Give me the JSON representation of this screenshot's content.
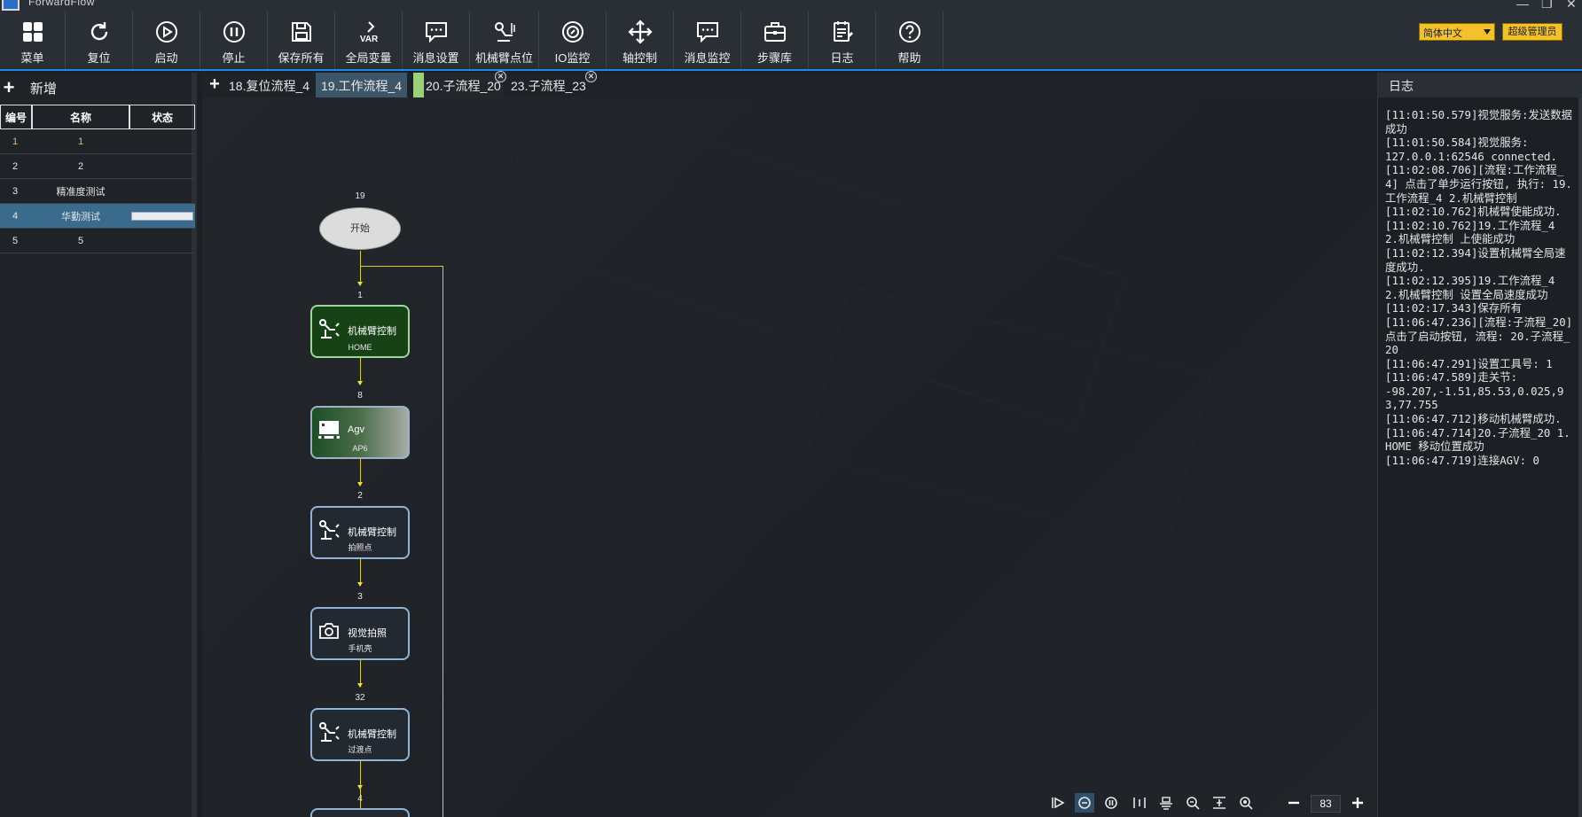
{
  "window": {
    "title": "ForwardFlow",
    "controls": [
      "—",
      "❐",
      "✕"
    ]
  },
  "toolbar": {
    "items": [
      {
        "label": "菜单",
        "icon": "grid-icon"
      },
      {
        "label": "复位",
        "icon": "reset-icon"
      },
      {
        "label": "启动",
        "icon": "play-icon"
      },
      {
        "label": "停止",
        "icon": "pause-icon"
      },
      {
        "label": "保存所有",
        "icon": "save-icon"
      },
      {
        "label": "全局变量",
        "icon": "var-icon",
        "icon_text": "VAR"
      },
      {
        "label": "消息设置",
        "icon": "message-settings-icon"
      },
      {
        "label": "机械臂点位",
        "icon": "robot-arm-points-icon"
      },
      {
        "label": "IO监控",
        "icon": "io-monitor-icon"
      },
      {
        "label": "轴控制",
        "icon": "axis-control-icon"
      },
      {
        "label": "消息监控",
        "icon": "message-monitor-icon"
      },
      {
        "label": "步骤库",
        "icon": "toolbox-icon"
      },
      {
        "label": "日志",
        "icon": "log-icon"
      },
      {
        "label": "帮助",
        "icon": "help-icon"
      }
    ],
    "language": "简体中文",
    "role": "超级管理员"
  },
  "left_panel": {
    "add_label": "新增",
    "columns": [
      "编号",
      "名称",
      "状态"
    ],
    "rows": [
      {
        "id": "1",
        "name": "1",
        "status": ""
      },
      {
        "id": "2",
        "name": "2",
        "status": ""
      },
      {
        "id": "3",
        "name": "精准度测试",
        "status": ""
      },
      {
        "id": "4",
        "name": "华勤测试",
        "status": "progress",
        "progress": 0.02
      },
      {
        "id": "5",
        "name": "5",
        "status": ""
      }
    ],
    "selected_index": 3
  },
  "tabs": [
    {
      "label": "18.复位流程_4",
      "state": "normal"
    },
    {
      "label": "19.工作流程_4",
      "state": "active"
    },
    {
      "label": "20.子流程_20",
      "state": "running",
      "closable": true
    },
    {
      "label": "23.子流程_23",
      "state": "normal",
      "closable": true
    }
  ],
  "flow": {
    "start": {
      "label": "开始",
      "number": "19"
    },
    "nodes": [
      {
        "number": "1",
        "title": "机械臂控制",
        "sub": "HOME",
        "style": "green",
        "icon": "robot-arm-icon"
      },
      {
        "number": "8",
        "title": "Agv",
        "sub": "AP6",
        "style": "grad",
        "icon": "agv-icon"
      },
      {
        "number": "2",
        "title": "机械臂控制",
        "sub": "拍照点",
        "style": "normal",
        "icon": "robot-arm-icon"
      },
      {
        "number": "3",
        "title": "视觉拍照",
        "sub": "手机壳",
        "style": "normal",
        "icon": "camera-icon"
      },
      {
        "number": "32",
        "title": "机械臂控制",
        "sub": "过渡点",
        "style": "normal",
        "icon": "robot-arm-icon"
      }
    ],
    "next_number": "4"
  },
  "canvas_tools": {
    "items": [
      "step-run-icon",
      "stop-circle-icon",
      "pause-circle-icon",
      "align-vertical-icon",
      "align-horizontal-icon",
      "zoom-fit-icon",
      "distribute-icon",
      "locate-icon"
    ],
    "active_index": 1,
    "zoom": "83"
  },
  "log": {
    "title": "日志",
    "text": "[11:01:50.579]视觉服务:发送数据成功\n[11:01:50.584]视觉服务:\n127.0.0.1:62546 connected.\n[11:02:08.706][流程:工作流程_4] 点击了单步运行按钮, 执行: 19.工作流程_4 2.机械臂控制\n[11:02:10.762]机械臂使能成功.\n[11:02:10.762]19.工作流程_4 2.机械臂控制 上使能成功\n[11:02:12.394]设置机械臂全局速度成功.\n[11:02:12.395]19.工作流程_4 2.机械臂控制 设置全局速度成功\n[11:02:17.343]保存所有\n[11:06:47.236][流程:子流程_20] 点击了启动按钮, 流程: 20.子流程_20\n[11:06:47.291]设置工具号: 1\n[11:06:47.589]走关节:\n-98.207,-1.51,85.53,0.025,93,77.755\n[11:06:47.712]移动机械臂成功.\n[11:06:47.714]20.子流程_20 1.HOME 移动位置成功\n[11:06:47.719]连接AGV: 0"
  },
  "colors": {
    "accent": "#1e88e5",
    "badge": "#f3c22b",
    "selected_row": "#3a6b8d",
    "connector": "#d9cb2a"
  }
}
